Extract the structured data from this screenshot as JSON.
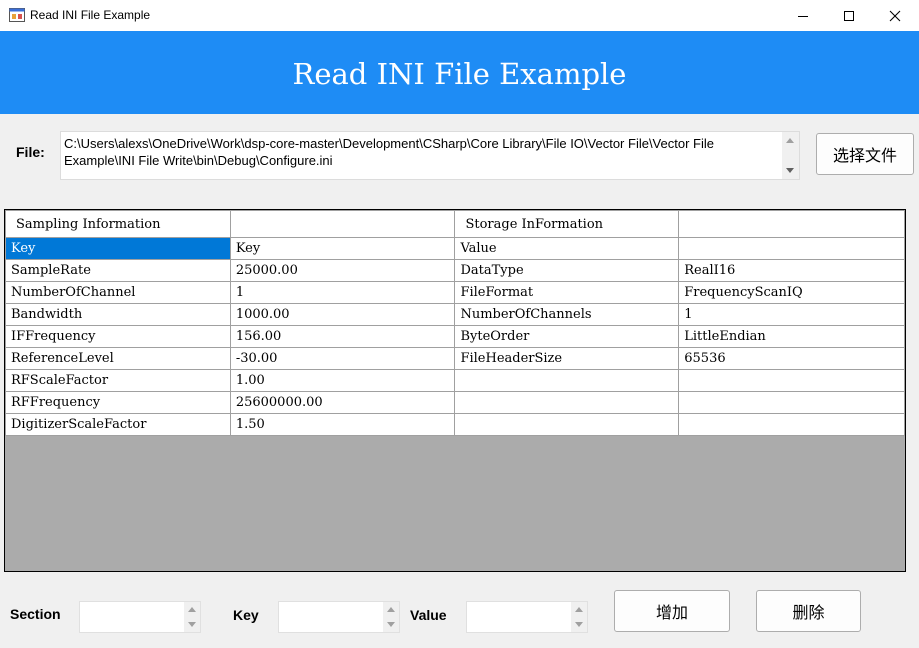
{
  "window": {
    "title": "Read INI File Example",
    "controls": {
      "minimize": "minimize-icon",
      "maximize": "maximize-icon",
      "close": "close-icon"
    }
  },
  "banner": {
    "title": "Read INI File Example",
    "color": "#1e8cf5"
  },
  "file": {
    "label": "File:",
    "path": "C:\\Users\\alexs\\OneDrive\\Work\\dsp-core-master\\Development\\CSharp\\Core Library\\File IO\\Vector File\\Vector File Example\\INI File Write\\bin\\Debug\\Configure.ini",
    "choose_button": "选择文件"
  },
  "grid": {
    "headers": [
      "Sampling Information",
      "",
      "Storage InFormation",
      ""
    ],
    "rows": [
      [
        "Key",
        "Key",
        "Value",
        ""
      ],
      [
        "SampleRate",
        "25000.00",
        "DataType",
        "RealI16"
      ],
      [
        "NumberOfChannel",
        "1",
        "FileFormat",
        "FrequencyScanIQ"
      ],
      [
        "Bandwidth",
        "1000.00",
        "NumberOfChannels",
        "1"
      ],
      [
        "IFFrequency",
        "156.00",
        "ByteOrder",
        "LittleEndian"
      ],
      [
        "ReferenceLevel",
        "-30.00",
        "FileHeaderSize",
        "65536"
      ],
      [
        "RFScaleFactor",
        "1.00",
        "",
        ""
      ],
      [
        "RFFrequency",
        "25600000.00",
        "",
        ""
      ],
      [
        "DigitizerScaleFactor",
        "1.50",
        "",
        ""
      ]
    ],
    "selected_color": "#0078d7"
  },
  "editor": {
    "section_label": "Section",
    "key_label": "Key",
    "value_label": "Value",
    "section_value": "",
    "key_value": "",
    "value_value": "",
    "add_button": "增加",
    "delete_button": "删除"
  }
}
